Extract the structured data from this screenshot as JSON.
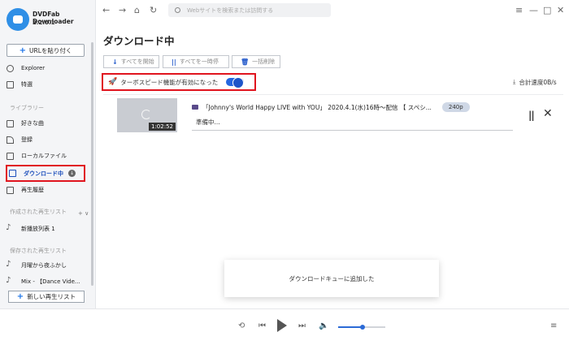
{
  "app": {
    "name": "DVDFab Downloader",
    "version": "2.2.0.1"
  },
  "sidebar": {
    "paste_url_label": "URLを貼り付く",
    "explorer": "Explorer",
    "featured": "特選",
    "library_label": "ライブラリー",
    "library_items": [
      "好きな曲",
      "登録",
      "ローカルファイル",
      "ダウンロード中",
      "再生履歴"
    ],
    "created_playlists_label": "作成された再生リスト",
    "created_playlists": [
      "新播放列表 1"
    ],
    "saved_playlists_label": "保存された再生リスト",
    "saved_playlists": [
      "月曜から夜ふかし",
      "Mix - 【Dance Vide..."
    ],
    "new_playlist_label": "新しい再生リスト"
  },
  "topbar": {
    "search_placeholder": "Webサイトを検索または訪問する"
  },
  "main": {
    "title": "ダウンロード中",
    "actions": [
      "すべてを開始",
      "すべてを一時停",
      "一括削除"
    ],
    "turbo_label": "ターボスピード機能が有効になった",
    "turbo_on": true,
    "speed_label": "合計速度0B/s"
  },
  "download": {
    "title": "「Johnny's World Happy LIVE with YOU」 2020.4.1(水)16時～配信 【 スペシ...",
    "quality": "240p",
    "duration": "1:02:52",
    "status": "準備中..."
  },
  "toast": {
    "message": "ダウンロードキューに追加した"
  },
  "player": {
    "volume": 0.5
  },
  "colors": {
    "accent": "#2466e0",
    "highlight_border": "#e0141e"
  }
}
